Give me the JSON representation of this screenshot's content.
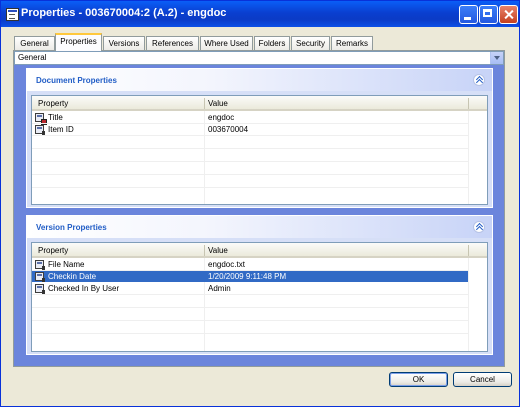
{
  "window": {
    "title": "Properties - 003670004:2 (A.2) - engdoc"
  },
  "tabs": [
    "General",
    "Properties",
    "Versions",
    "References",
    "Where Used",
    "Folders",
    "Security",
    "Remarks"
  ],
  "active_tab": "Properties",
  "view_select": {
    "value": "General"
  },
  "document_properties": {
    "title": "Document Properties",
    "columns": {
      "property": "Property",
      "value": "Value"
    },
    "rows": [
      {
        "name": "Title",
        "value": "engdoc",
        "icon": "lock-doc-icon"
      },
      {
        "name": "Item ID",
        "value": "003670004",
        "icon": "doc-icon"
      }
    ]
  },
  "version_properties": {
    "title": "Version Properties",
    "columns": {
      "property": "Property",
      "value": "Value"
    },
    "rows": [
      {
        "name": "File Name",
        "value": "engdoc.txt",
        "icon": "doc-icon"
      },
      {
        "name": "Checkin Date",
        "value": "1/20/2009 9:11:48 PM",
        "icon": "doc-icon",
        "selected": true
      },
      {
        "name": "Checked In By User",
        "value": "Admin",
        "icon": "doc-icon"
      }
    ]
  },
  "buttons": {
    "ok": "OK",
    "cancel": "Cancel"
  },
  "colors": {
    "title_bar": "#0a4fd9",
    "section_title": "#215dc6",
    "selection": "#316ac5",
    "panel_bg": "#6b85dc"
  }
}
